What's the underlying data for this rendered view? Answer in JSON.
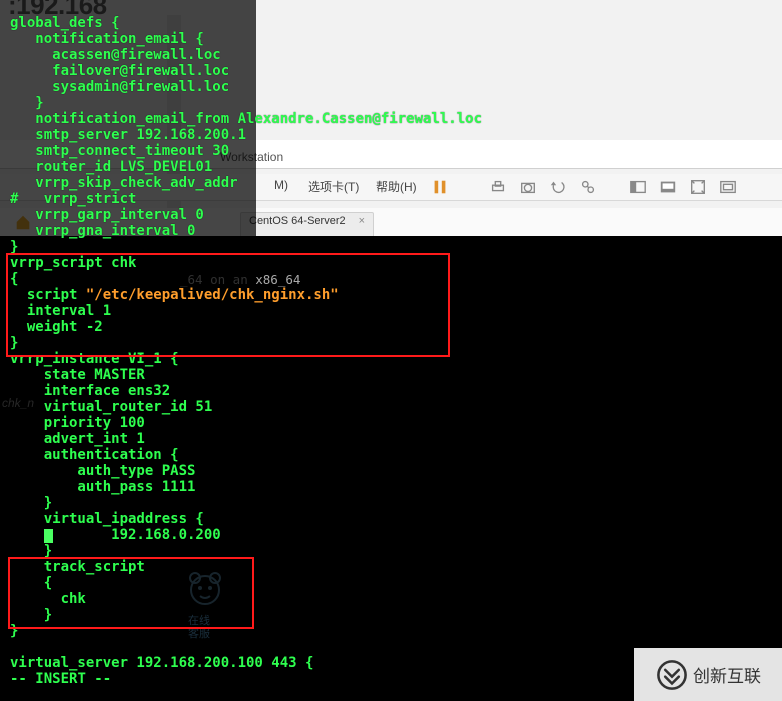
{
  "background_ip": ":192.168",
  "vmware": {
    "title": "Workstation",
    "menu": {
      "m": "M)",
      "tabs": "选项卡(T)",
      "help": "帮助(H)"
    },
    "tab_label": "CentOS 64-Server2",
    "guest_text": "_64 on an x86_64",
    "bear": {
      "line1": "在线",
      "line2": "客服"
    }
  },
  "chk_label": "chk_n",
  "logo_text": "创新互联",
  "code": {
    "l1": "global_defs {",
    "l2": "   notification_email {",
    "l3": "     acassen@firewall.loc",
    "l4": "     failover@firewall.loc",
    "l5": "     sysadmin@firewall.loc",
    "l6": "   }",
    "l7": "   notification_email_from Alexandre.Cassen@firewall.loc",
    "l8": "   smtp_server 192.168.200.1",
    "l9": "   smtp_connect_timeout 30",
    "l10": "   router_id LVS_DEVEL01",
    "l11": "   vrrp_skip_check_adv_addr",
    "l12": "#   vrrp_strict",
    "l13": "   vrrp_garp_interval 0",
    "l14": "   vrrp_gna_interval 0",
    "l15": "}",
    "l16": "vrrp_script chk",
    "l17": "{",
    "l18a": "  script ",
    "l18b": "\"/etc/keepalived/chk_nginx.sh\"",
    "l19": "  interval 1",
    "l20": "  weight -2",
    "l21": "}",
    "l22": "vrrp_instance VI_1 {",
    "l23": "    state MASTER",
    "l24": "    interface ens32",
    "l25": "    virtual_router_id 51",
    "l26": "    priority 100",
    "l27": "    advert_int 1",
    "l28": "    authentication {",
    "l29": "        auth_type PASS",
    "l30": "        auth_pass 1111",
    "l31": "    }",
    "l32": "    virtual_ipaddress {",
    "l33": "        192.168.0.200",
    "l34": "    }",
    "l35": "    track_script",
    "l36": "    {",
    "l37": "      chk",
    "l38": "    }",
    "l39": "}",
    "l40": "",
    "l41": "virtual_server 192.168.200.100 443 {",
    "l42a": "-- ",
    "l42b": "INSERT",
    "l42c": " --"
  }
}
